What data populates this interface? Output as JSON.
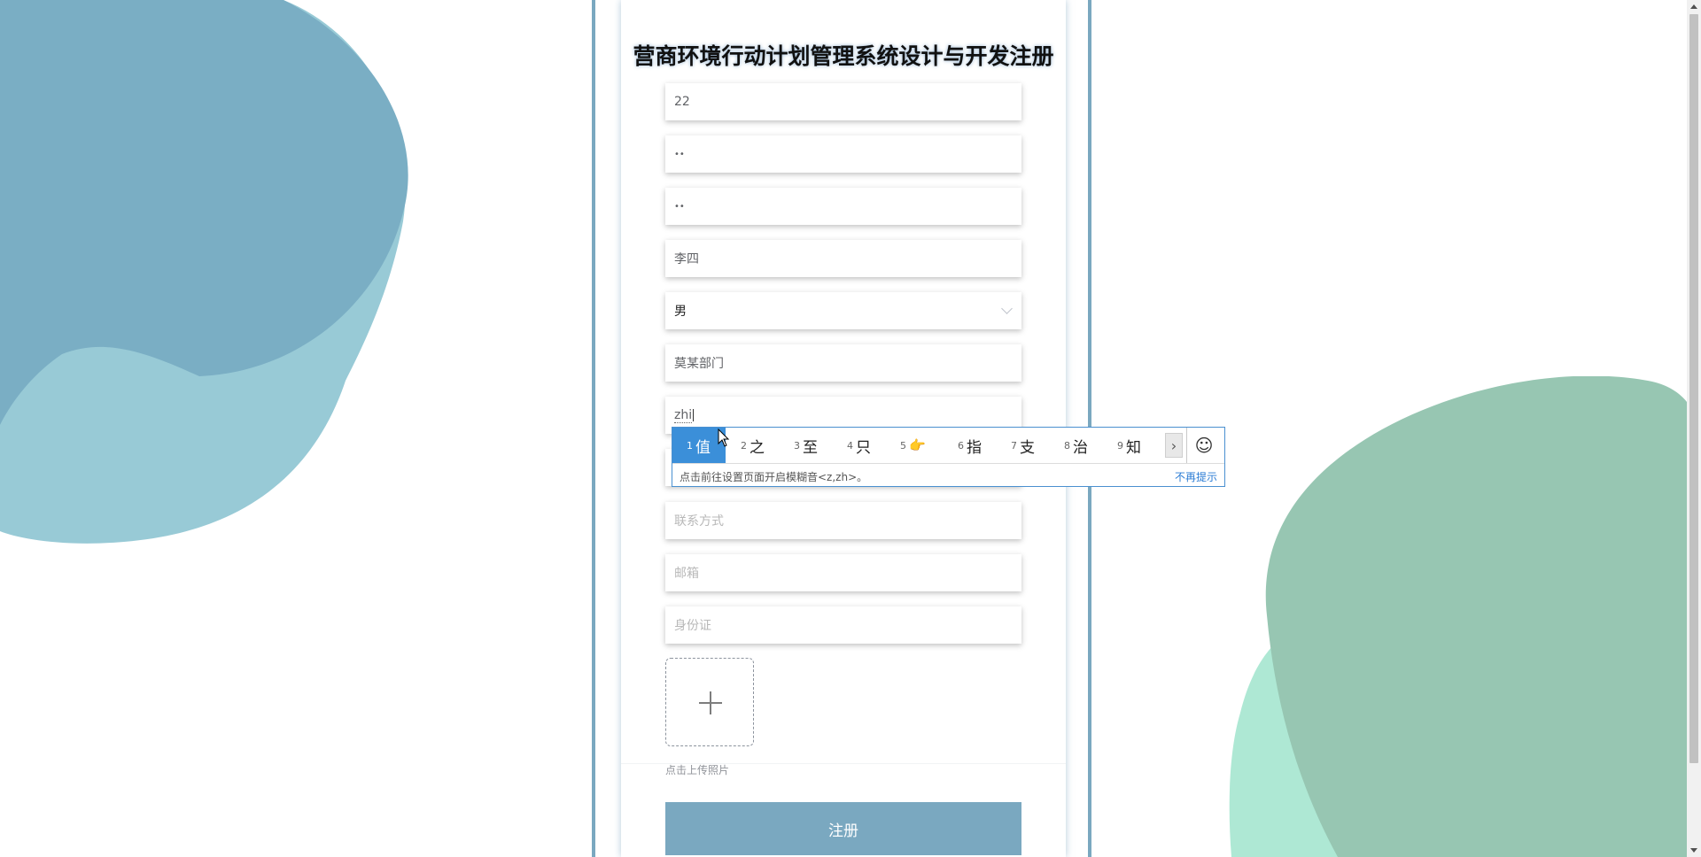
{
  "page": {
    "title": "营商环境行动计划管理系统设计与开发注册"
  },
  "colors": {
    "accent": "#7aa8c0",
    "blob_blue_dark": "#7aaec4",
    "blob_blue_light": "#98cad6",
    "blob_green_dark": "#97c6b2",
    "blob_green_light": "#aee8d4"
  },
  "form": {
    "account": {
      "value": "22"
    },
    "password": {
      "value": "••"
    },
    "confirm_password": {
      "value": "••"
    },
    "name": {
      "value": "李四"
    },
    "gender": {
      "value": "男"
    },
    "department": {
      "value": "莫某部门"
    },
    "position": {
      "value": "zhi"
    },
    "phone": {
      "placeholder": "联系方式"
    },
    "email": {
      "placeholder": "邮箱"
    },
    "id_card": {
      "placeholder": "身份证"
    },
    "upload_hint": "点击上传照片",
    "submit_label": "注册"
  },
  "ime": {
    "candidates": [
      {
        "num": "1",
        "text": "值"
      },
      {
        "num": "2",
        "text": "之"
      },
      {
        "num": "3",
        "text": "至"
      },
      {
        "num": "4",
        "text": "只"
      },
      {
        "num": "5",
        "text": "👉"
      },
      {
        "num": "6",
        "text": "指"
      },
      {
        "num": "7",
        "text": "支"
      },
      {
        "num": "8",
        "text": "治"
      },
      {
        "num": "9",
        "text": "知"
      }
    ],
    "next_label": "›",
    "emoji_label": "☺",
    "tip": "点击前往设置页面开启模糊音<z,zh>。",
    "dismiss": "不再提示"
  }
}
